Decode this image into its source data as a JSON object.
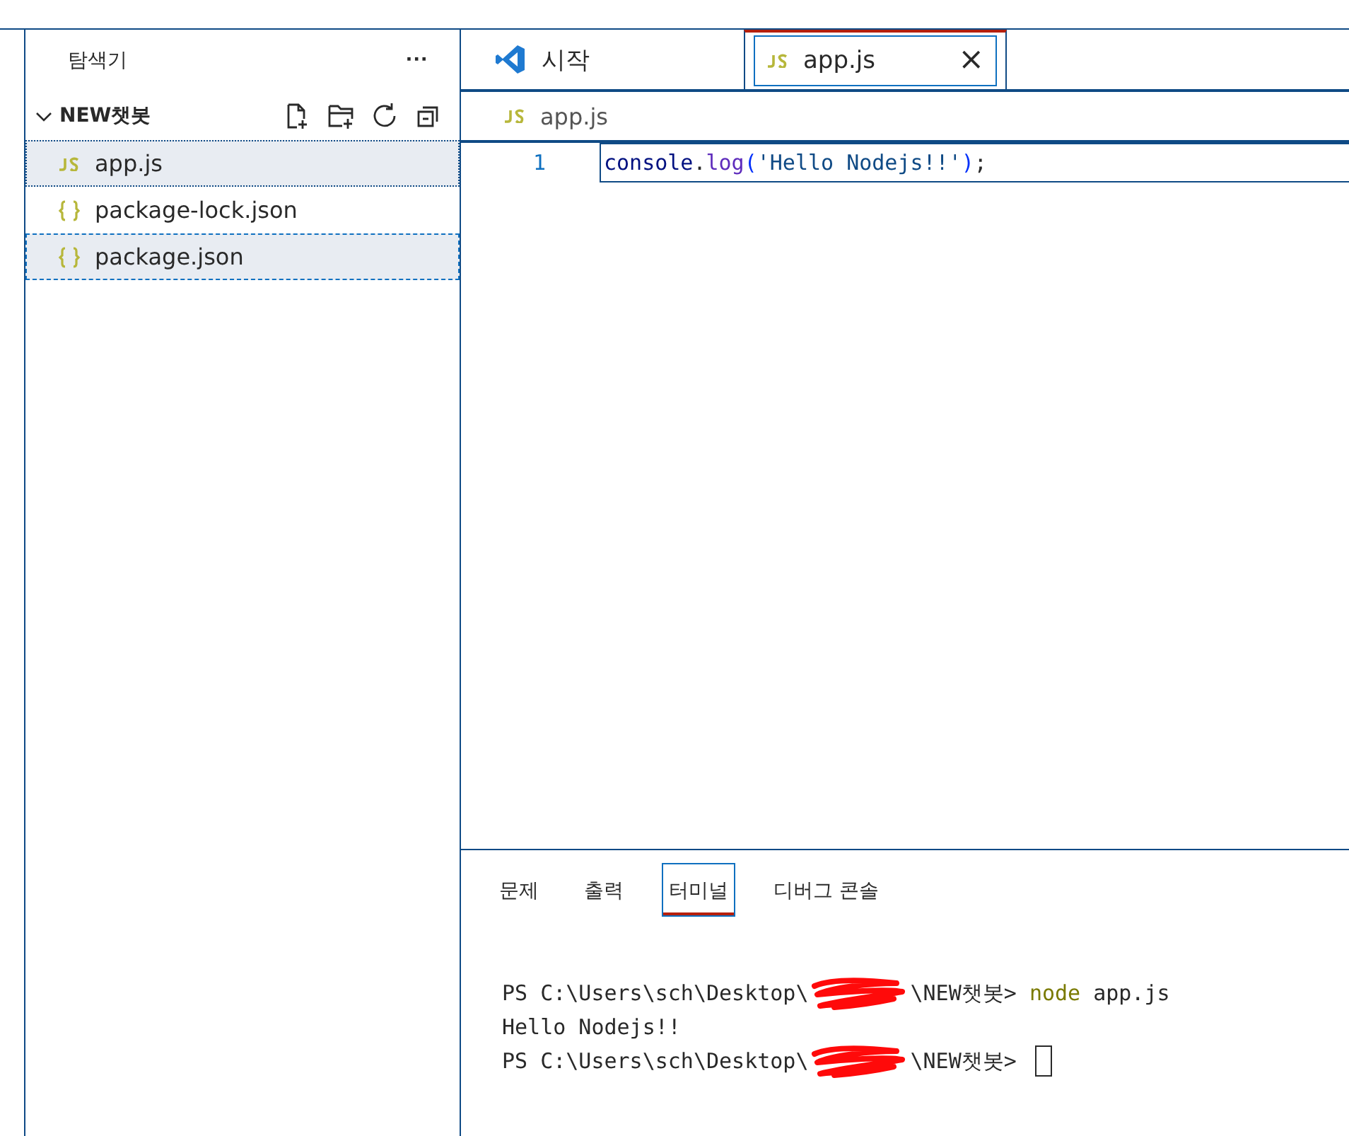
{
  "sidebar": {
    "title": "탐색기",
    "more": "···",
    "folder": {
      "name": "NEW챗봇",
      "expanded": true
    },
    "files": [
      {
        "name": "app.js",
        "kind": "js",
        "selected": true,
        "focused": false
      },
      {
        "name": "package-lock.json",
        "kind": "json",
        "selected": false,
        "focused": false
      },
      {
        "name": "package.json",
        "kind": "json",
        "selected": true,
        "focused": true
      }
    ]
  },
  "tabs": [
    {
      "label": "시작",
      "kind": "welcome",
      "selected": false
    },
    {
      "label": "app.js",
      "kind": "js",
      "selected": true,
      "close": "×"
    }
  ],
  "breadcrumb": {
    "label": "app.js",
    "kind": "js"
  },
  "code": [
    {
      "number": "1",
      "tokens": [
        {
          "kind": "variable",
          "text": "console"
        },
        {
          "kind": "plain",
          "text": "."
        },
        {
          "kind": "function",
          "text": "log"
        },
        {
          "kind": "paren",
          "text": "("
        },
        {
          "kind": "string",
          "text": "'Hello Nodejs!!'"
        },
        {
          "kind": "paren",
          "text": ")"
        },
        {
          "kind": "plain",
          "text": ";"
        }
      ]
    }
  ],
  "panel_tabs": [
    {
      "label": "문제",
      "selected": false
    },
    {
      "label": "출력",
      "selected": false
    },
    {
      "label": "터미널",
      "selected": true
    },
    {
      "label": "디버그 콘솔",
      "selected": false
    }
  ],
  "terminal": [
    [
      {
        "kind": "text",
        "text": "PS C:\\Users\\sch\\Desktop\\"
      },
      {
        "kind": "redacted"
      },
      {
        "kind": "text",
        "text": "\\NEW챗봇> "
      },
      {
        "kind": "command",
        "text": "node"
      },
      {
        "kind": "text",
        "text": " app.js"
      }
    ],
    [
      {
        "kind": "text",
        "text": "Hello Nodejs!!"
      }
    ],
    [
      {
        "kind": "text",
        "text": "PS C:\\Users\\sch\\Desktop\\"
      },
      {
        "kind": "redacted"
      },
      {
        "kind": "text",
        "text": "\\NEW챗봇> "
      },
      {
        "kind": "cursor"
      }
    ]
  ]
}
